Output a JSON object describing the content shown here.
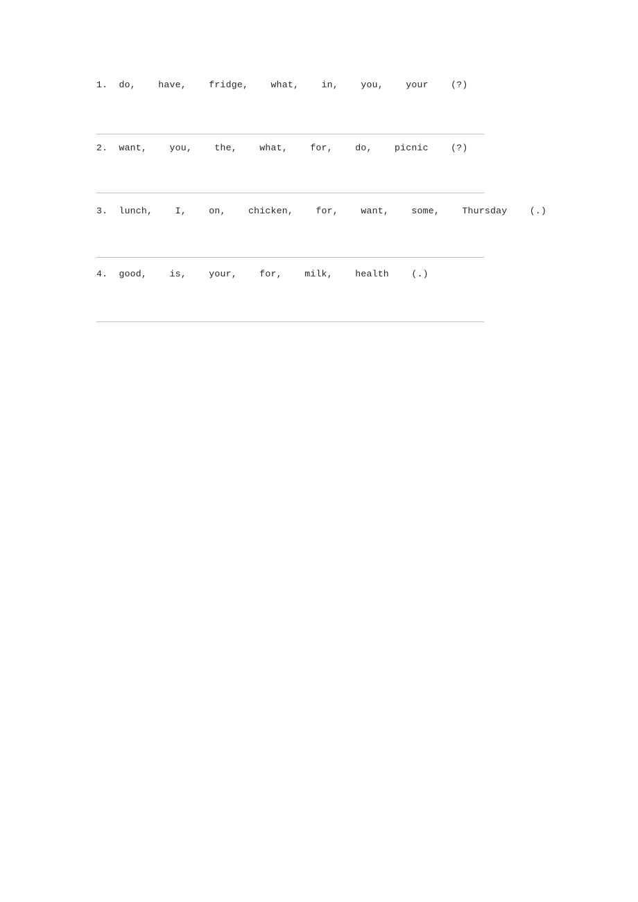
{
  "page": {
    "background_color": "#ffffff",
    "text_color": "#262626",
    "rule_color": "#bfbfbf"
  },
  "worksheet": {
    "exercises": [
      {
        "number": "1.",
        "words": [
          "do,",
          "have,",
          "fridge,",
          "what,",
          "in,",
          "you,",
          "your"
        ],
        "end_mark": "(?)",
        "line": "1.  do,    have,    fridge,    what,    in,    you,    your    (?)"
      },
      {
        "number": "2.",
        "words": [
          "want,",
          "you,",
          "the,",
          "what,",
          "for,",
          "do,",
          "picnic"
        ],
        "end_mark": "(?)",
        "line": "2.  want,    you,    the,    what,    for,    do,    picnic    (?)"
      },
      {
        "number": "3.",
        "words": [
          "lunch,",
          "I,",
          "on,",
          "chicken,",
          "for,",
          "want,",
          "some,",
          "Thursday"
        ],
        "end_mark": "(.)",
        "line": "3.  lunch,    I,    on,    chicken,    for,    want,    some,    Thursday    (.)"
      },
      {
        "number": "4.",
        "words": [
          "good,",
          "is,",
          "your,",
          "for,",
          "milk,",
          "health"
        ],
        "end_mark": "(.)",
        "line": "4.  good,    is,    your,    for,    milk,    health    (.)"
      }
    ]
  }
}
